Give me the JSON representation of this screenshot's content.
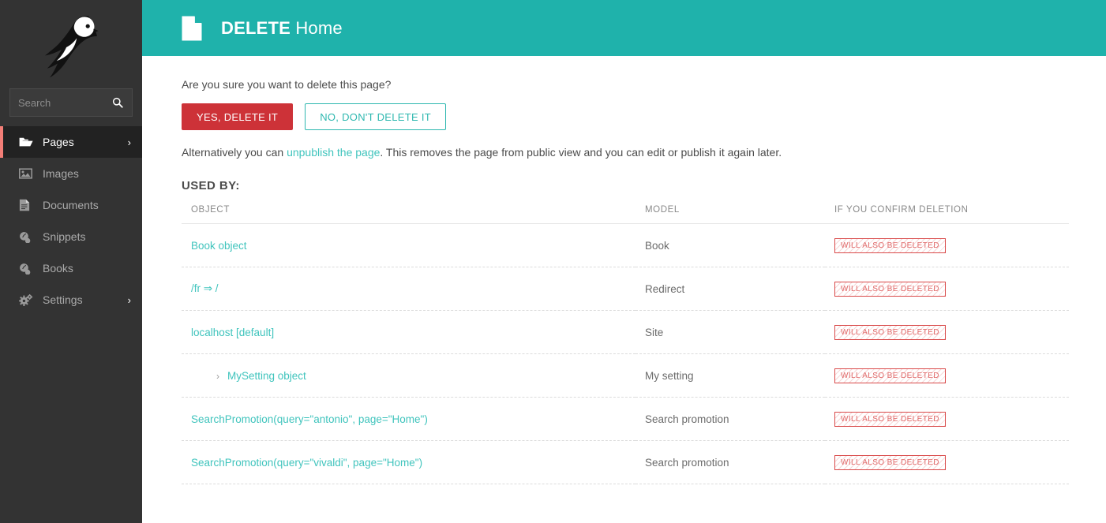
{
  "sidebar": {
    "logo_name": "wagtail-bird-logo",
    "search": {
      "placeholder": "Search",
      "value": "",
      "icon": "search-icon"
    },
    "items": [
      {
        "label": "Pages",
        "icon": "folder-open-icon",
        "active": true,
        "arrow": "›"
      },
      {
        "label": "Images",
        "icon": "image-icon",
        "active": false,
        "arrow": ""
      },
      {
        "label": "Documents",
        "icon": "document-icon",
        "active": false,
        "arrow": ""
      },
      {
        "label": "Snippets",
        "icon": "snippet-icon",
        "active": false,
        "arrow": ""
      },
      {
        "label": "Books",
        "icon": "snippet-icon",
        "active": false,
        "arrow": ""
      },
      {
        "label": "Settings",
        "icon": "cogs-icon",
        "active": false,
        "arrow": "›"
      }
    ]
  },
  "header": {
    "icon": "page-doc-icon",
    "action": "DELETE",
    "title": "Home"
  },
  "main": {
    "confirm_question": "Are you sure you want to delete this page?",
    "confirm_button": "YES, DELETE IT",
    "cancel_button": "NO, DON'T DELETE IT",
    "alternative": {
      "before": "Alternatively you can ",
      "link": "unpublish the page",
      "after": ". This removes the page from public view and you can edit or publish it again later."
    },
    "used_by_title": "USED BY:",
    "table": {
      "columns": [
        "OBJECT",
        "MODEL",
        "IF YOU CONFIRM DELETION"
      ],
      "rows": [
        {
          "object": "Book object",
          "model": "Book",
          "action": "WILL ALSO BE DELETED",
          "child": false
        },
        {
          "object": "/fr ⇒ /",
          "model": "Redirect",
          "action": "WILL ALSO BE DELETED",
          "child": false
        },
        {
          "object": "localhost [default]",
          "model": "Site",
          "action": "WILL ALSO BE DELETED",
          "child": false
        },
        {
          "object": "MySetting object",
          "model": "My setting",
          "action": "WILL ALSO BE DELETED",
          "child": true,
          "chevron": "›"
        },
        {
          "object": "SearchPromotion(query=\"antonio\", page=\"Home\")",
          "model": "Search promotion",
          "action": "WILL ALSO BE DELETED",
          "child": false
        },
        {
          "object": "SearchPromotion(query=\"vivaldi\", page=\"Home\")",
          "model": "Search promotion",
          "action": "WILL ALSO BE DELETED",
          "child": false
        }
      ]
    }
  },
  "colors": {
    "teal": "#1fb2ab",
    "teal_link": "#40c4bd",
    "danger": "#cd3238",
    "sidebar_bg": "#333333",
    "sidebar_active_bg": "#222222",
    "sidebar_active_accent": "#f37e77",
    "badge_border": "#d94a4a"
  }
}
